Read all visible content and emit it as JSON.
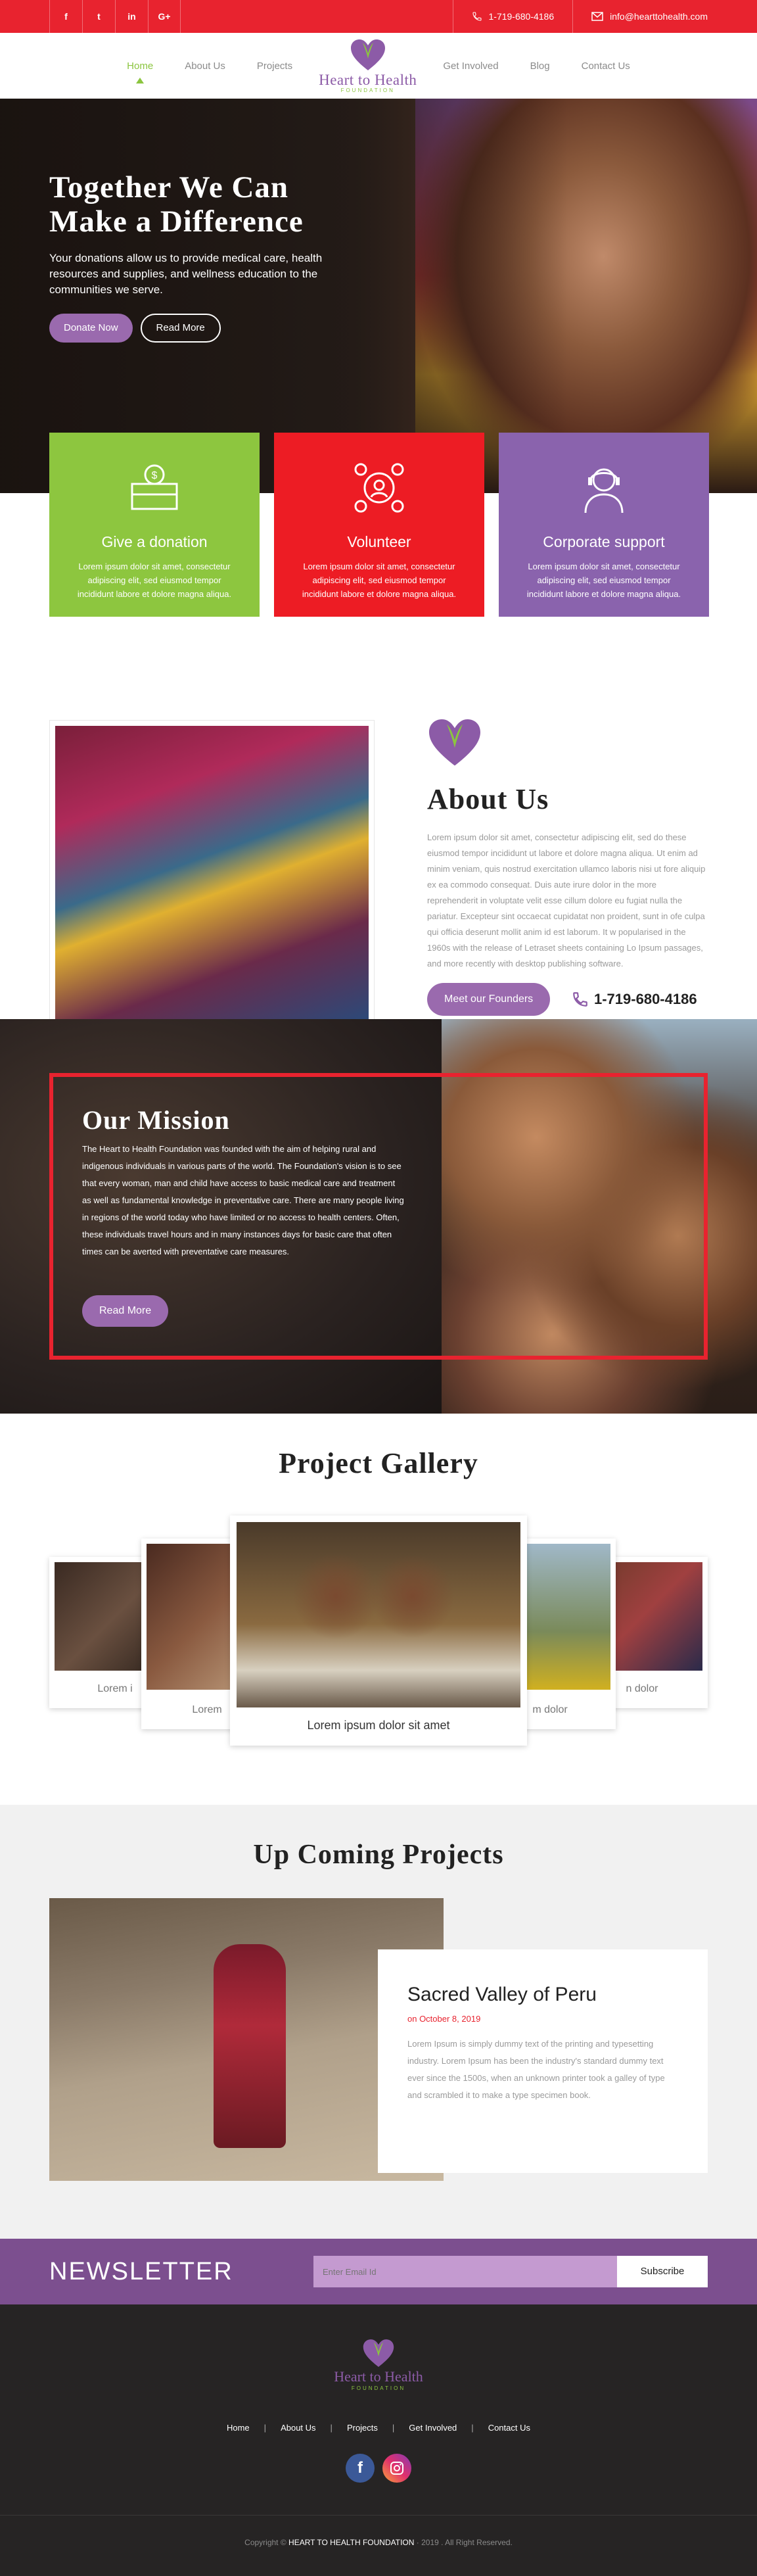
{
  "topbar": {
    "social": [
      "f",
      "t",
      "in",
      "G+"
    ],
    "phone": "1-719-680-4186",
    "email": "info@hearttohealth.com"
  },
  "nav": {
    "items_left": [
      "Home",
      "About Us",
      "Projects"
    ],
    "items_right": [
      "Get Involved",
      "Blog",
      "Contact Us"
    ],
    "active": "Home",
    "logo_name": "Heart to Health",
    "logo_sub": "FOUNDATION"
  },
  "hero": {
    "title_line1": "Together We Can",
    "title_line2": "Make a Difference",
    "text": "Your donations allow us to provide medical care, health resources and supplies, and wellness education to the communities we serve.",
    "btn_donate": "Donate Now",
    "btn_read": "Read More"
  },
  "cards": [
    {
      "title": "Give a donation",
      "text": "Lorem ipsum dolor sit amet, consectetur adipiscing elit, sed eiusmod tempor incididunt labore et dolore magna aliqua.",
      "color": "#8dc63f",
      "icon": "donation-icon"
    },
    {
      "title": "Volunteer",
      "text": "Lorem ipsum dolor sit amet, consectetur adipiscing elit, sed eiusmod tempor incididunt labore et dolore magna aliqua.",
      "color": "#ed1c24",
      "icon": "volunteer-icon"
    },
    {
      "title": "Corporate support",
      "text": "Lorem ipsum dolor sit amet, consectetur adipiscing elit, sed eiusmod tempor incididunt labore et dolore magna aliqua.",
      "color": "#8a63ad",
      "icon": "support-icon"
    }
  ],
  "about": {
    "title": "About Us",
    "text": "Lorem ipsum dolor sit amet, consectetur adipiscing elit, sed do these eiusmod tempor incididunt ut labore et dolore magna aliqua. Ut enim ad minim veniam, quis nostrud exercitation ullamco laboris nisi ut fore aliquip ex ea commodo consequat. Duis aute irure dolor in the more reprehenderit in voluptate velit esse cillum dolore eu fugiat nulla the pariatur. Excepteur sint occaecat cupidatat non proident, sunt in ofe culpa qui officia deserunt mollit anim id est laborum. It w popularised in the 1960s with the release of Letraset sheets containing Lo Ipsum passages, and more recently with desktop publishing software.",
    "btn": "Meet our Founders",
    "phone": "1-719-680-4186"
  },
  "mission": {
    "title": "Our Mission",
    "text": "The Heart to Health Foundation was founded with the aim of helping rural and indigenous individuals in various parts of the world. The Foundation's vision is to see that every woman, man and child have access to basic medical care and treatment as well as fundamental knowledge in preventative care. There are many people living in regions of the world today who have limited or no access to health centers. Often, these individuals travel hours and in many instances days for basic care that often times can be averted with preventative care measures.",
    "btn": "Read More"
  },
  "gallery": {
    "title": "Project Gallery",
    "captions": [
      "Lorem i",
      "Lorem",
      "Lorem ipsum dolor sit amet",
      "m dolor",
      "n dolor"
    ]
  },
  "upcoming": {
    "title": "Up Coming Projects",
    "project_title": "Sacred Valley of Peru",
    "date": "on October 8, 2019",
    "text": "Lorem Ipsum is simply dummy text of the printing and typesetting industry. Lorem Ipsum has been the industry's standard dummy text ever since the 1500s, when an unknown printer took a galley of type and scrambled it to make a type specimen book."
  },
  "newsletter": {
    "title": "NEWSLETTER",
    "placeholder": "Enter Email Id",
    "btn": "Subscribe"
  },
  "footer": {
    "links": [
      "Home",
      "About Us",
      "Projects",
      "Get Involved",
      "Contact Us"
    ],
    "copyright_pre": "Copyright ©",
    "copyright_org": "HEART TO HEALTH FOUNDATION",
    "copyright_post": "· 2019 . All Right Reserved."
  },
  "colors": {
    "red": "#e8232f",
    "green": "#8bc53f",
    "purple": "#8c5ba7",
    "dark": "#262424"
  }
}
